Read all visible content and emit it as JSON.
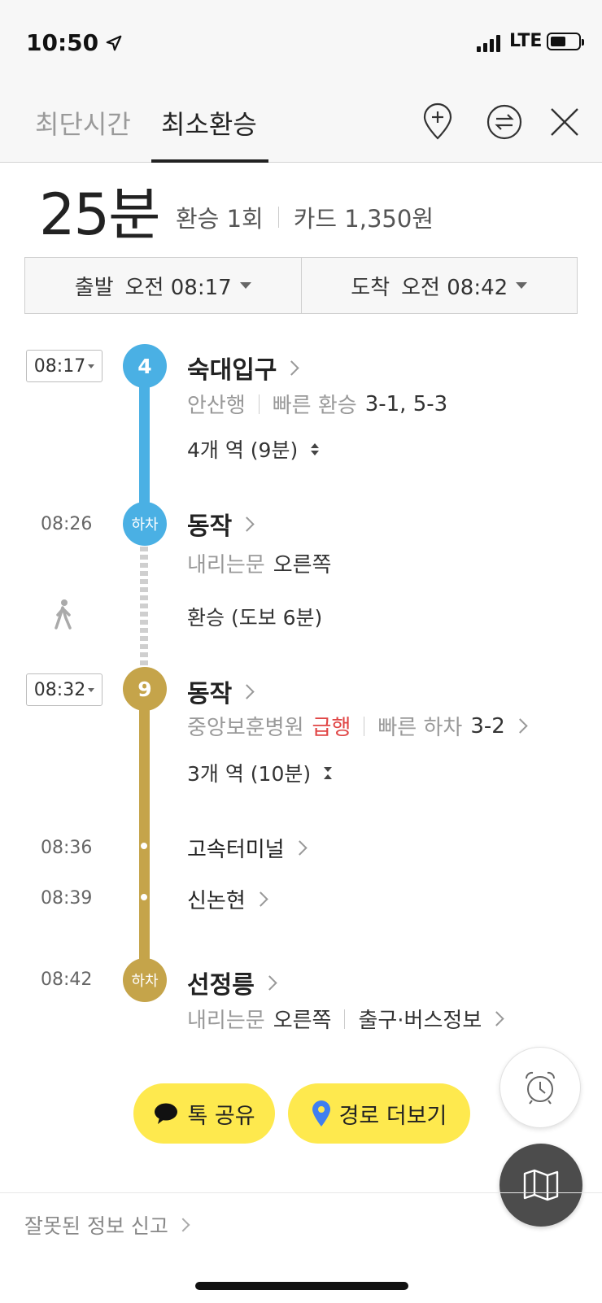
{
  "status_bar": {
    "time": "10:50",
    "network": "LTE"
  },
  "tabs": [
    {
      "label": "최단시간",
      "active": false
    },
    {
      "label": "최소환승",
      "active": true
    }
  ],
  "header_icons": [
    "add-location-icon",
    "swap-icon",
    "close-icon"
  ],
  "summary": {
    "duration": "25분",
    "transfers": "환승 1회",
    "fare": "카드 1,350원"
  },
  "time_selector": {
    "departure_label": "출발",
    "departure_time": "오전 08:17",
    "arrival_label": "도착",
    "arrival_time": "오전 08:42"
  },
  "segments": {
    "line4": {
      "badge": "4",
      "color": "#4ab0e4",
      "depart_time": "08:17",
      "station": "숙대입구",
      "direction": "안산행",
      "fast_transfer_label": "빠른 환승",
      "fast_transfer_value": "3-1, 5-3",
      "stops": "4개 역 (9분)",
      "alight_time": "08:26",
      "alight_badge": "하차",
      "alight_station": "동작",
      "door_label": "내리는문",
      "door_value": "오른쪽"
    },
    "walk": {
      "text": "환승 (도보 6분)"
    },
    "line9": {
      "badge": "9",
      "color": "#c5a44a",
      "depart_time": "08:32",
      "station": "동작",
      "direction": "중앙보훈병원",
      "express": "급행",
      "fast_alight_label": "빠른 하차",
      "fast_alight_value": "3-2",
      "stops": "3개 역 (10분)",
      "mid_stops": [
        {
          "time": "08:36",
          "name": "고속터미널"
        },
        {
          "time": "08:39",
          "name": "신논현"
        }
      ],
      "alight_time": "08:42",
      "alight_badge": "하차",
      "alight_station": "선정릉",
      "door_label": "내리는문",
      "door_value": "오른쪽",
      "exit_info": "출구·버스정보"
    }
  },
  "buttons": {
    "share": "톡 공유",
    "more_routes": "경로 더보기"
  },
  "footer": {
    "report": "잘못된 정보 신고"
  },
  "colors": {
    "accent_yellow": "#fee94e",
    "express_red": "#e04444"
  }
}
